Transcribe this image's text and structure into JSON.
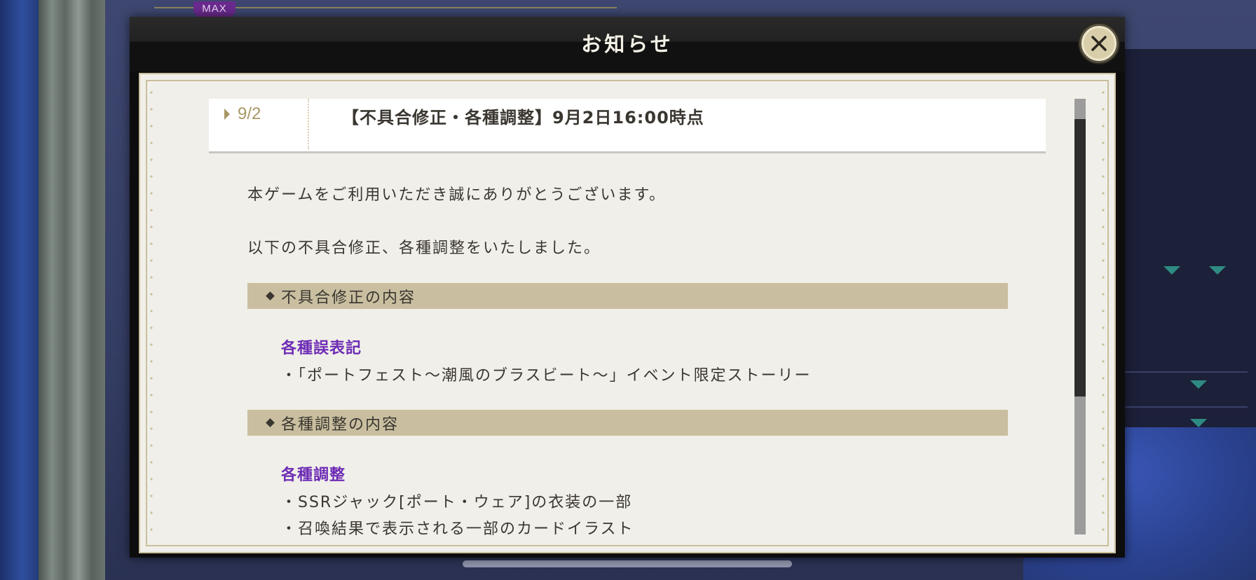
{
  "badge": {
    "max_label": "MAX"
  },
  "modal": {
    "title": "お知らせ",
    "close_icon": "close-icon"
  },
  "news_item": {
    "date": "9/2",
    "title": "【不具合修正・各種調整】9月2日16:00時点"
  },
  "body": {
    "greeting": "本ゲームをご利用いただき誠にありがとうございます。",
    "intro": "以下の不具合修正、各種調整をいたしました。",
    "sections": [
      {
        "heading": "不具合修正の内容",
        "subheading": "各種誤表記",
        "items": [
          "・「ポートフェスト～潮風のブラスビート～」イベント限定ストーリー"
        ]
      },
      {
        "heading": "各種調整の内容",
        "subheading": "各種調整",
        "items": [
          "・SSRジャック[ポート・ウェア]の衣装の一部",
          "・召喚結果で表示される一部のカードイラスト"
        ]
      }
    ]
  },
  "colors": {
    "accent_purple": "#6d2cb5",
    "section_band": "#c9bfa0",
    "date_gold": "#a89766",
    "paper": "#f1efe9"
  }
}
